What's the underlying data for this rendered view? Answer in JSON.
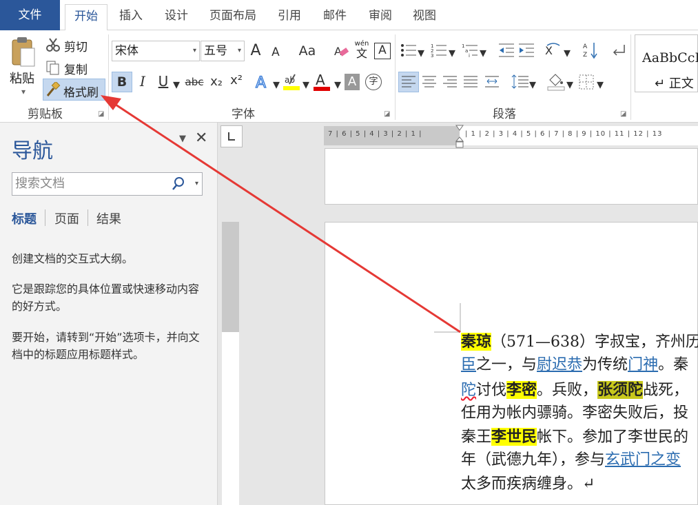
{
  "tabs": {
    "file": "文件",
    "home": "开始",
    "insert": "插入",
    "design": "设计",
    "layout": "页面布局",
    "references": "引用",
    "mailings": "邮件",
    "review": "审阅",
    "view": "视图"
  },
  "clipboard": {
    "paste": "粘贴",
    "cut": "剪切",
    "copy": "复制",
    "format_painter": "格式刷",
    "label": "剪贴板"
  },
  "font": {
    "name": "宋体",
    "size": "五号",
    "label": "字体",
    "bold": "B",
    "italic": "I",
    "underline": "U",
    "strike": "abc",
    "subscript": "x₂",
    "superscript": "x²",
    "grow": "A",
    "shrink": "A",
    "case": "Aa",
    "phonetic_top": "wén",
    "phonetic_bottom": "文",
    "border_char": "A",
    "color_char": "A",
    "shading_char": "A",
    "enclose_char": "字"
  },
  "paragraph": {
    "label": "段落"
  },
  "styles": {
    "preview": "AaBbCcD",
    "normal": "↵ 正文"
  },
  "nav": {
    "title": "导航",
    "search_placeholder": "搜索文档",
    "tab_headings": "标题",
    "tab_pages": "页面",
    "tab_results": "结果",
    "text1": "创建文档的交互式大纲。",
    "text2": "它是跟踪您的具体位置或快速移动内容的好方式。",
    "text3": "要开始，请转到“开始”选项卡，并向文档中的标题应用标题样式。"
  },
  "ruler": {
    "top_left": "7 | 6 | 5 | 4 | 3 | 2 | 1 |",
    "top_right": "| 1 | 2 | 3 | 4 | 5 | 6 | 7 | 8 | 9 | 10 | 11 | 12 | 13"
  },
  "document": {
    "l1a": "秦琼",
    "l1b": "（571—638）字叔宝，齐州历",
    "l2a": "臣",
    "l2b": "之一，与",
    "l2c": "尉迟恭",
    "l2d": "为传统",
    "l2e": "门神",
    "l2f": "。秦",
    "l3a": "陀",
    "l3b": "讨伐",
    "l3c": "李密",
    "l3d": "。兵败，",
    "l3e": "张须陀",
    "l3f": "战死，",
    "l4": "任用为帐内骠骑。李密失败后，投",
    "l5a": "秦王",
    "l5b": "李世民",
    "l5c": "帐下。参加了李世民的",
    "l6a": "年（武德九年），参与",
    "l6b": "玄武门之变",
    "l7": "太多而疾病缠身。↵"
  },
  "colors": {
    "accent": "#2b579a",
    "arrow": "#e53935",
    "highlight": "#ffff00"
  }
}
